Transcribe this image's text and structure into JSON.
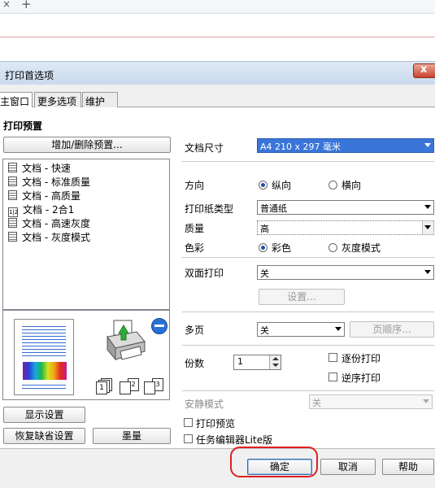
{
  "browser": {
    "close_glyph": "×",
    "new_tab_glyph": "+"
  },
  "window": {
    "title": "打印首选项",
    "close_glyph": "x"
  },
  "tabs": [
    {
      "label": "主窗口",
      "selected": true
    },
    {
      "label": "更多选项",
      "selected": false
    },
    {
      "label": "维护",
      "selected": false
    }
  ],
  "presets": {
    "heading": "打印预置",
    "add_remove_button": "增加/删除预置...",
    "items": [
      {
        "label": "文档 - 快速",
        "icon": "doc-icon"
      },
      {
        "label": "文档 - 标准质量",
        "icon": "doc-icon"
      },
      {
        "label": "文档 - 高质量",
        "icon": "doc-icon"
      },
      {
        "label": "文档 - 2合1",
        "icon": "two-up-icon",
        "badge": "1|2"
      },
      {
        "label": "文档 - 高速灰度",
        "icon": "doc-icon"
      },
      {
        "label": "文档 - 灰度模式",
        "icon": "doc-icon"
      }
    ]
  },
  "preview": {
    "copies_icons": [
      "1",
      "2",
      "3"
    ],
    "display_settings_button": "显示设置",
    "restore_defaults_button": "恢复缺省设置",
    "ink_button": "墨量"
  },
  "settings": {
    "paper_size_label": "文档尺寸",
    "paper_size_value": "A4 210 x 297 毫米",
    "orientation_label": "方向",
    "portrait_label": "纵向",
    "landscape_label": "横向",
    "orientation_selected": "portrait",
    "paper_type_label": "打印纸类型",
    "paper_type_value": "普通纸",
    "quality_label": "质量",
    "quality_value": "高",
    "color_label": "色彩",
    "color_option": "彩色",
    "grayscale_option": "灰度模式",
    "color_selected": "color",
    "duplex_label": "双面打印",
    "duplex_value": "关",
    "duplex_settings_button": "设置...",
    "multipage_label": "多页",
    "multipage_value": "关",
    "page_order_button": "页顺序...",
    "copies_label": "份数",
    "copies_value": "1",
    "collate_label": "逐份打印",
    "reverse_label": "逆序打印",
    "quiet_mode_label": "安静模式",
    "quiet_mode_value": "关",
    "print_preview_label": "打印预览",
    "job_arranger_label": "任务编辑器Lite版"
  },
  "footer": {
    "ok_button": "确定",
    "cancel_button": "取消",
    "help_button": "帮助"
  },
  "colors": {
    "highlight_ring": "#e02020",
    "selection_blue": "#3a75d8"
  }
}
